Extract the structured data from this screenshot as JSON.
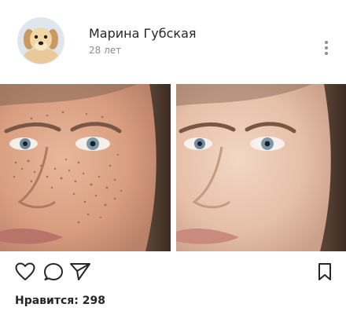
{
  "post": {
    "user_name": "Марина Губская",
    "user_age": "28 лет",
    "likes_text": "Нравится: 298"
  },
  "icons": {
    "avatar": "puppy-avatar",
    "more": "more-vertical-icon",
    "like": "heart-icon",
    "comment": "comment-icon",
    "share": "paper-plane-icon",
    "save": "bookmark-icon"
  },
  "photos": {
    "before": "freckled-face-before",
    "after": "clear-skin-face-after"
  },
  "colors": {
    "text": "#262626",
    "secondary": "#8e8e8e",
    "background": "#ffffff"
  }
}
